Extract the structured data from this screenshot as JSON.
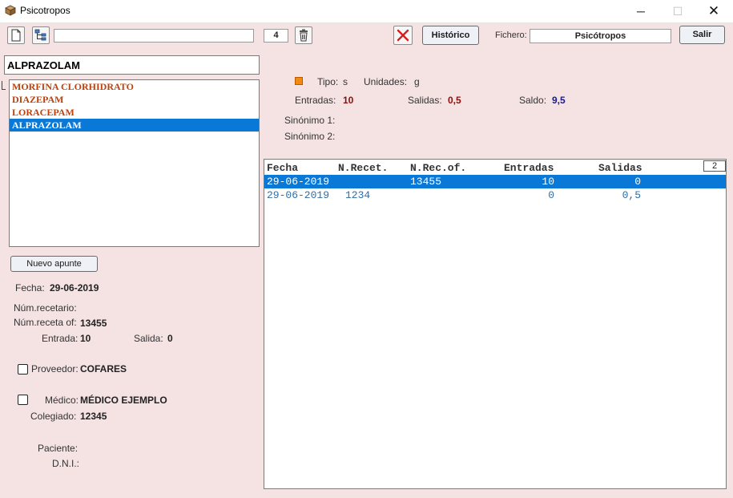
{
  "window": {
    "title": "Psicotropos",
    "minimize": "─",
    "maximize": "☐",
    "close": "✕"
  },
  "toolbar": {
    "search_value": "",
    "count": "4",
    "historico_label": "Histórico",
    "fichero_label": "Fichero:",
    "fichero_value": "Psicótropos",
    "salir_label": "Salir"
  },
  "search": {
    "value": "ALPRAZOLAM"
  },
  "list": [
    "MORFINA CLORHIDRATO",
    "DIAZEPAM",
    "LORACEPAM",
    "ALPRAZOLAM"
  ],
  "detail": {
    "tipo_label": "Tipo:",
    "tipo_value": "s",
    "unidades_label": "Unidades:",
    "unidades_value": "g",
    "entradas_label": "Entradas:",
    "entradas_value": "10",
    "salidas_label": "Salidas:",
    "salidas_value": "0,5",
    "saldo_label": "Saldo:",
    "saldo_value": "9,5",
    "sinonimo1_label": "Sinónimo 1:",
    "sinonimo2_label": "Sinónimo 2:"
  },
  "table": {
    "headers": [
      "Fecha",
      "N.Recet.",
      "N.Rec.of.",
      "Entradas",
      "Salidas"
    ],
    "count": "2",
    "rows": [
      {
        "fecha": "29-06-2019",
        "nrecet": "",
        "nrecof": "13455",
        "entradas": "10",
        "salidas": "0"
      },
      {
        "fecha": "29-06-2019",
        "nrecet": "1234",
        "nrecof": "",
        "entradas": "0",
        "salidas": "0,5"
      }
    ]
  },
  "form": {
    "nuevo_label": "Nuevo apunte",
    "fecha_label": "Fecha:",
    "fecha_value": "29-06-2019",
    "num_recetario_label": "Núm.recetario:",
    "num_receta_of_label": "Núm.receta of:",
    "num_receta_of_value": "13455",
    "entrada_label": "Entrada:",
    "entrada_value": "10",
    "salida_label": "Salida:",
    "salida_value": "0",
    "proveedor_label": "Proveedor:",
    "proveedor_value": "COFARES",
    "medico_label": "Médico:",
    "medico_value": "MÉDICO EJEMPLO",
    "colegiado_label": "Colegiado:",
    "colegiado_value": "12345",
    "paciente_label": "Paciente:",
    "dni_label": "D.N.I.:"
  },
  "colors": {
    "background": "#f5e3e3",
    "selection": "#0a78d7",
    "list_text": "#c0400a"
  }
}
